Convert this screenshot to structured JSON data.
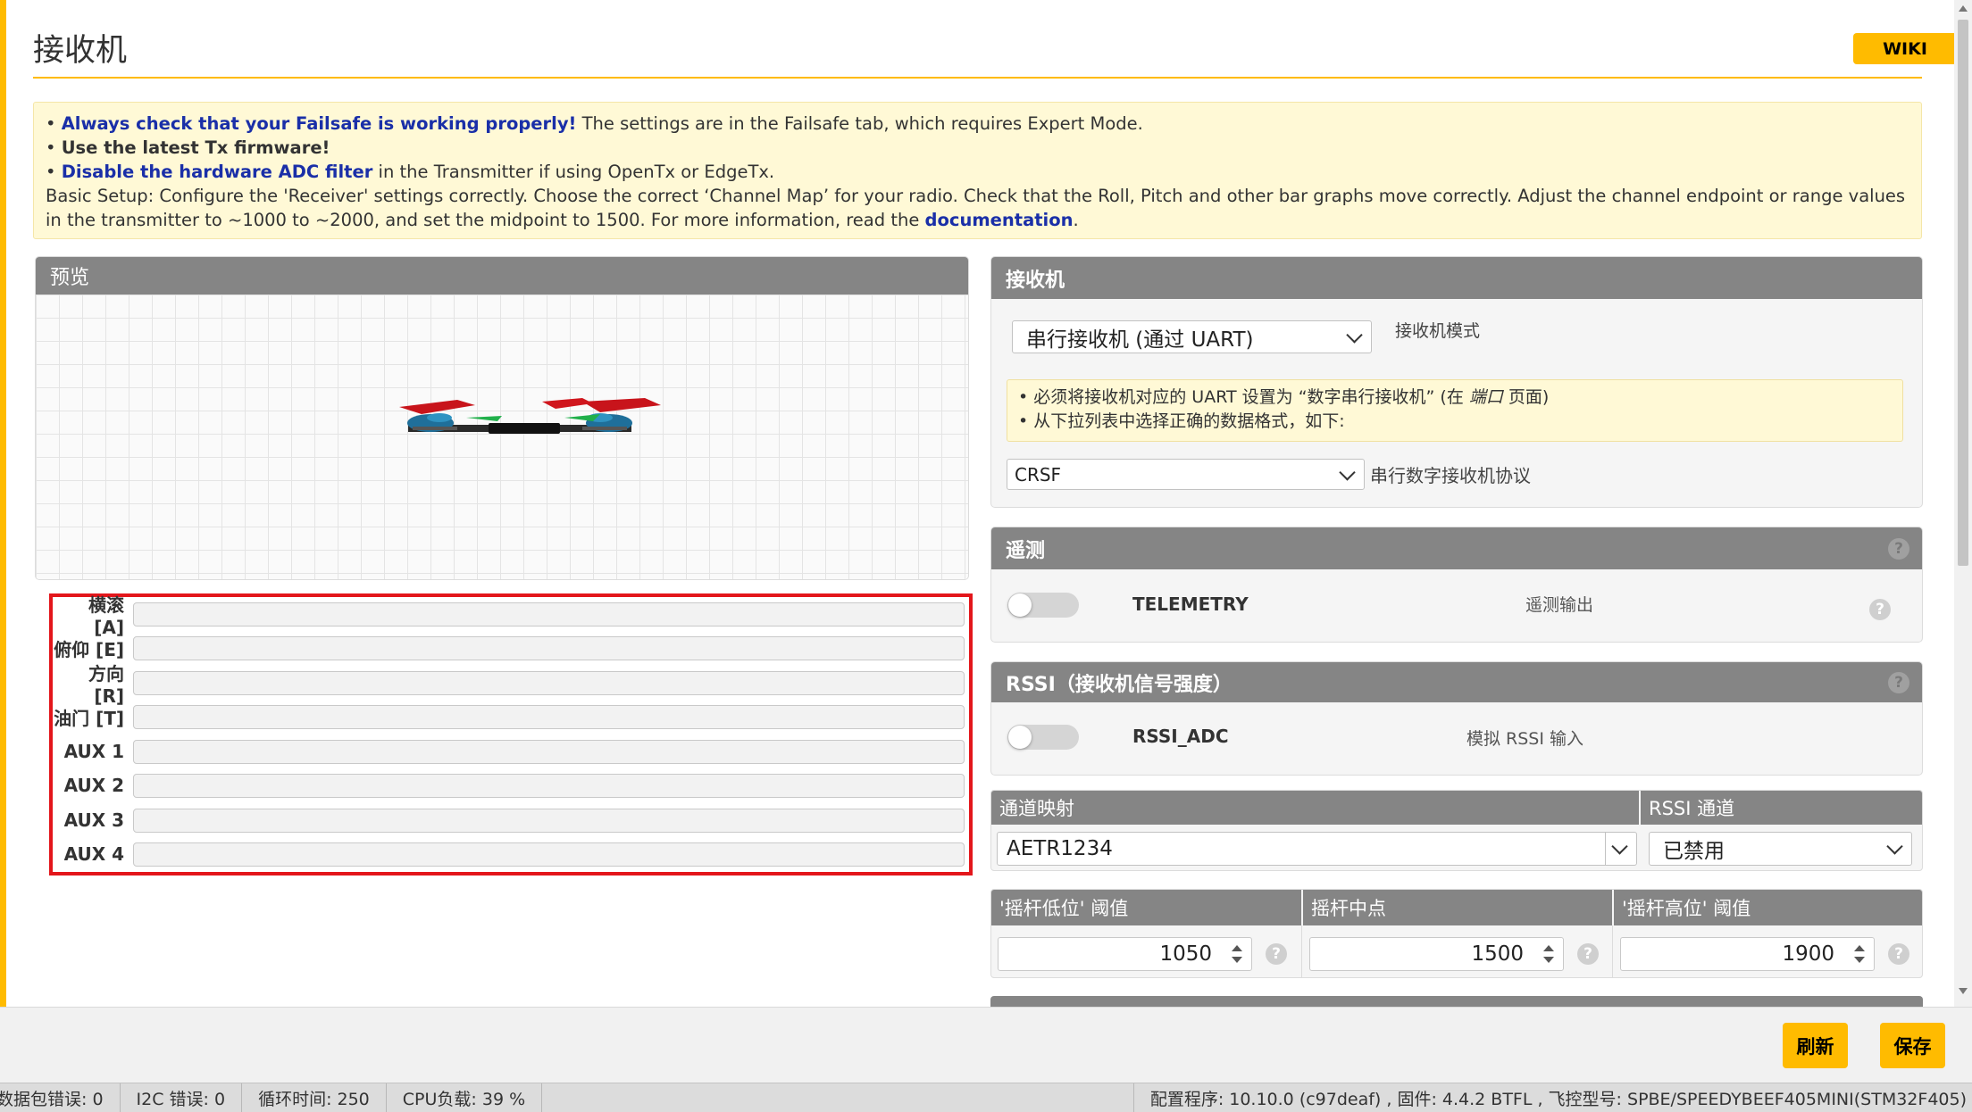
{
  "page": {
    "title": "接收机",
    "wiki_label": "WIKI"
  },
  "note": {
    "line1_bold": "Always check that your Failsafe is working properly!",
    "line1_rest": " The settings are in the Failsafe tab, which requires Expert Mode.",
    "line2_bold": "Use the latest Tx firmware!",
    "line3_bold": "Disable the hardware ADC filter",
    "line3_rest": " in the Transmitter if using OpenTx or EdgeTx.",
    "basic_setup": "Basic Setup: Configure the 'Receiver' settings correctly. Choose the correct ‘Channel Map’ for your radio. Check that the Roll, Pitch and other bar graphs move correctly. Adjust the channel endpoint or range values in the transmitter to ~1000 to ~2000, and set the midpoint to 1500. For more information, read the ",
    "doc_link": "documentation",
    "doc_end": "."
  },
  "preview": {
    "title": "预览",
    "channels": [
      {
        "label": "横滚 [A]"
      },
      {
        "label": "俯仰 [E]"
      },
      {
        "label": "方向 [R]"
      },
      {
        "label": "油门 [T]"
      },
      {
        "label": "AUX 1"
      },
      {
        "label": "AUX 2"
      },
      {
        "label": "AUX 3"
      },
      {
        "label": "AUX 4"
      }
    ]
  },
  "receiver": {
    "title": "接收机",
    "mode_value": "串行接收机 (通过 UART)",
    "mode_label": "接收机模式",
    "info_1a": "• 必须将接收机对应的 UART 设置为 “数字串行接收机” (在 ",
    "info_1b": "端口",
    "info_1c": " 页面)",
    "info_2": "• 从下拉列表中选择正确的数据格式，如下:",
    "protocol_value": "CRSF",
    "protocol_label": "串行数字接收机协议"
  },
  "telemetry": {
    "title": "遥测",
    "feature": "TELEMETRY",
    "desc": "遥测输出",
    "enabled": false
  },
  "rssi": {
    "title": "RSSI（接收机信号强度）",
    "feature": "RSSI_ADC",
    "desc": "模拟 RSSI 输入",
    "enabled": false
  },
  "channel_map": {
    "label": "通道映射",
    "value": "AETR1234",
    "rssi_label": "RSSI 通道",
    "rssi_value": "已禁用"
  },
  "stick": {
    "low_label": "'摇杆低位' 阈值",
    "low_value": "1050",
    "center_label": "摇杆中点",
    "center_value": "1500",
    "high_label": "'摇杆高位' 阈值",
    "high_value": "1900"
  },
  "actions": {
    "refresh": "刷新",
    "save": "保存"
  },
  "status": {
    "packet_errors": "数据包错误: 0",
    "i2c_errors": "I2C 错误: 0",
    "cycle_time": "循环时间: 250",
    "cpu_load": "CPU负载: 39 %",
    "config_info": "配置程序: 10.10.0 (c97deaf) , 固件: 4.4.2 BTFL , 飞控型号: SPBE/SPEEDYBEEF405MINI(STM32F405)"
  },
  "colors": {
    "accent": "#ffbb00",
    "header_gray": "#858585",
    "highlight_red": "#e3161b",
    "link_blue": "#1a2fa8"
  }
}
